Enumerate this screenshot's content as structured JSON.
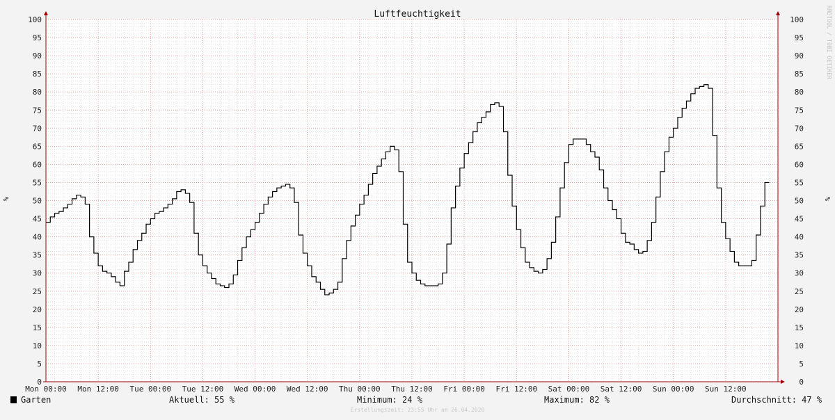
{
  "chart_data": {
    "type": "line",
    "title": "Luftfeuchtigkeit",
    "ylabel": "%",
    "ylim": [
      0,
      100
    ],
    "yticks": [
      0,
      5,
      10,
      15,
      20,
      25,
      30,
      35,
      40,
      45,
      50,
      55,
      60,
      65,
      70,
      75,
      80,
      85,
      90,
      95,
      100
    ],
    "xtick_labels": [
      "Mon 00:00",
      "Mon 12:00",
      "Tue 00:00",
      "Tue 12:00",
      "Wed 00:00",
      "Wed 12:00",
      "Thu 00:00",
      "Thu 12:00",
      "Fri 00:00",
      "Fri 12:00",
      "Sat 00:00",
      "Sat 12:00",
      "Sun 00:00",
      "Sun 12:00"
    ],
    "xrange_hours": [
      0,
      168
    ],
    "grid": true,
    "series": [
      {
        "name": "Garten",
        "color": "#000000",
        "x_hours": [
          0,
          1,
          2,
          3,
          4,
          5,
          6,
          7,
          8,
          9,
          10,
          11,
          12,
          13,
          14,
          15,
          16,
          17,
          18,
          19,
          20,
          21,
          22,
          23,
          24,
          25,
          26,
          27,
          28,
          29,
          30,
          31,
          32,
          33,
          34,
          35,
          36,
          37,
          38,
          39,
          40,
          41,
          42,
          43,
          44,
          45,
          46,
          47,
          48,
          49,
          50,
          51,
          52,
          53,
          54,
          55,
          56,
          57,
          58,
          59,
          60,
          61,
          62,
          63,
          64,
          65,
          66,
          67,
          68,
          69,
          70,
          71,
          72,
          73,
          74,
          75,
          76,
          77,
          78,
          79,
          80,
          81,
          82,
          83,
          84,
          85,
          86,
          87,
          88,
          89,
          90,
          91,
          92,
          93,
          94,
          95,
          96,
          97,
          98,
          99,
          100,
          101,
          102,
          103,
          104,
          105,
          106,
          107,
          108,
          109,
          110,
          111,
          112,
          113,
          114,
          115,
          116,
          117,
          118,
          119,
          120,
          121,
          122,
          123,
          124,
          125,
          126,
          127,
          128,
          129,
          130,
          131,
          132,
          133,
          134,
          135,
          136,
          137,
          138,
          139,
          140,
          141,
          142,
          143,
          144,
          145,
          146,
          147,
          148,
          149,
          150,
          151,
          152,
          153,
          154,
          155,
          156,
          157,
          158,
          159,
          160,
          161,
          162,
          163,
          164,
          165,
          166,
          167
        ],
        "values": [
          44,
          45.5,
          46.5,
          47,
          48,
          49,
          50.5,
          51.5,
          51,
          49,
          40,
          35.5,
          32,
          30.5,
          30,
          29,
          27.5,
          26.5,
          30.5,
          33,
          36.5,
          39,
          41,
          43.5,
          45,
          46.5,
          47,
          48,
          49,
          50.5,
          52.5,
          53,
          52,
          49.5,
          41,
          35,
          32,
          30,
          28.5,
          27,
          26.5,
          26,
          27,
          29.5,
          33.5,
          37,
          40,
          42,
          44,
          46.5,
          49,
          51,
          52.5,
          53.5,
          54,
          54.5,
          53.5,
          49.5,
          40.5,
          35.5,
          32,
          29,
          27.5,
          25.5,
          24,
          24.5,
          25.5,
          27.5,
          34,
          39,
          43,
          46,
          49,
          51.5,
          54.5,
          57.5,
          59.5,
          61.5,
          63.5,
          65,
          64,
          58,
          43.5,
          33,
          30,
          28,
          27,
          26.5,
          26.5,
          26.5,
          27,
          30,
          38,
          48,
          54,
          59,
          63,
          66,
          69,
          71.5,
          73,
          74.5,
          76.5,
          77,
          76,
          69,
          57,
          48.5,
          42,
          37,
          33,
          31.5,
          30.5,
          30,
          31,
          34,
          38.5,
          45.5,
          53.5,
          60.5,
          65.5,
          67,
          67,
          67,
          65.5,
          63.5,
          62,
          58.5,
          53.5,
          50,
          47.5,
          45,
          41,
          38.5,
          38,
          36.5,
          35.5,
          36,
          39,
          44,
          51,
          58,
          63.5,
          67.5,
          70,
          73,
          75.5,
          77.5,
          79.5,
          81,
          81.5,
          82,
          81,
          68,
          53.5,
          44,
          39.5,
          36,
          33,
          32,
          32,
          32,
          33.5,
          40.5,
          48.5,
          55
        ]
      }
    ]
  },
  "legend": {
    "series_name": "Garten",
    "current": "Aktuell:  55 %",
    "minimum": "Minimum:  24 %",
    "maximum": "Maximum:  82 %",
    "average": "Durchschnitt:  47 %"
  },
  "footer": {
    "created": "Erstellungszeit: 23:55 Uhr am 26.04.2020",
    "watermark": "RRDTOOL / TOBI OETIKER"
  },
  "colors": {
    "background": "#f3f3f3",
    "plot_background": "#ffffff",
    "grid_minor": "#e0e0e0",
    "grid_major": "#e8a0a0",
    "axis": "#a00000",
    "line": "#000000"
  }
}
